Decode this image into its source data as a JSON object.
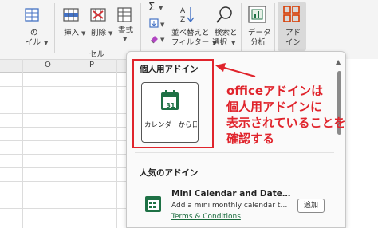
{
  "ribbon": {
    "clip_left_label_1": "の",
    "clip_left_label_2": "イル",
    "insert_label": "挿入",
    "delete_label": "削除",
    "format_label": "書式",
    "sort_filter_label_1": "並べ替えと",
    "sort_filter_label_2": "フィルター",
    "find_select_label_1": "検索と",
    "find_select_label_2": "選択",
    "data_analysis_label_1": "データ",
    "data_analysis_label_2": "分析",
    "addins_label_1": "アド",
    "addins_label_2": "イン",
    "cells_group_label": "セル"
  },
  "grid": {
    "column_o": "O",
    "column_p": "P"
  },
  "pane": {
    "personal_section_title": "個人用アドイン",
    "personal_addin_label": "カレンダーから日…",
    "calendar_day": "31",
    "popular_section_title": "人気のアドイン",
    "popular_addin_name": "Mini Calendar and Date…",
    "popular_addin_desc": "Add a mini monthly calendar t…",
    "popular_addin_link": "Terms & Conditions",
    "add_button_label": "追加"
  },
  "annotation": {
    "line1": "officeアドインは",
    "line2": "個人用アドインに",
    "line3": "表示されていることを",
    "line4": "確認する"
  },
  "colors": {
    "accent_red": "#e0242c",
    "excel_green": "#1e7145"
  }
}
